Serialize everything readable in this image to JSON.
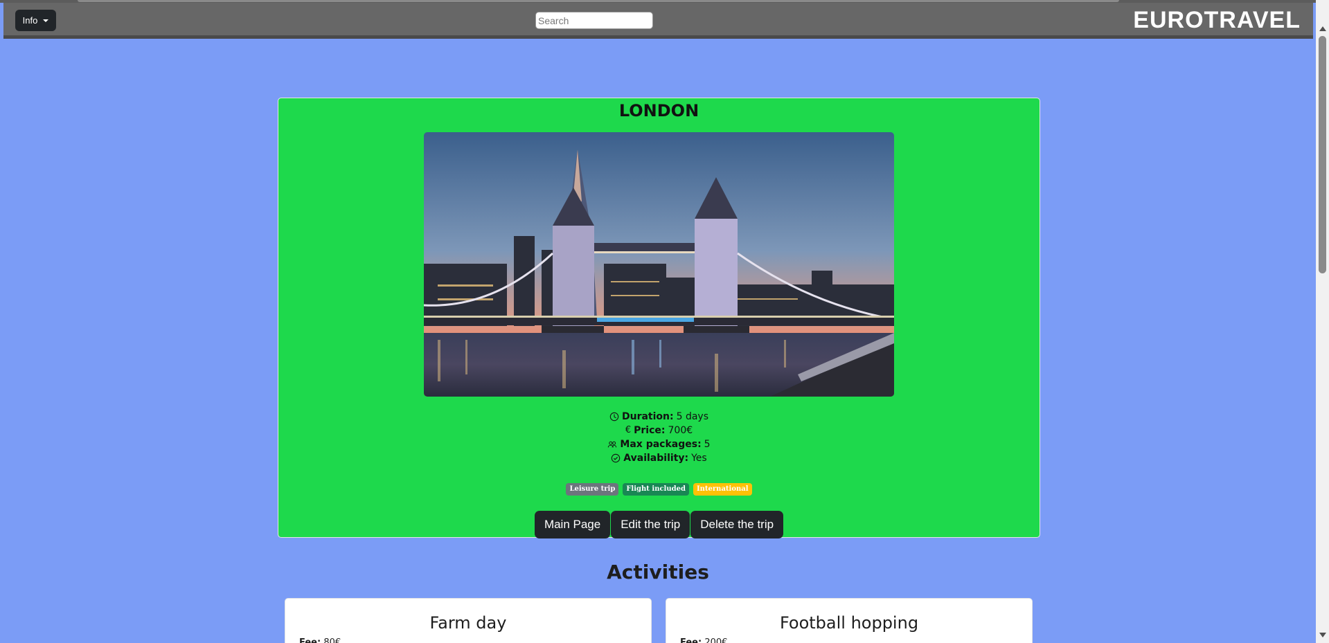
{
  "navbar": {
    "info_label": "Info",
    "search_placeholder": "Search",
    "brand": "EUROTRAVEL"
  },
  "trip": {
    "title": "LONDON",
    "image_alt": "London Tower Bridge at dusk",
    "details": [
      {
        "icon": "clock-icon",
        "label": "Duration:",
        "value": "5 days"
      },
      {
        "icon": "euro-icon",
        "label": "Price:",
        "value": "700€"
      },
      {
        "icon": "people-icon",
        "label": "Max packages:",
        "value": "5"
      },
      {
        "icon": "check-circle-icon",
        "label": "Availability:",
        "value": "Yes"
      }
    ],
    "badges": [
      {
        "label": "Leisure trip",
        "color": "#6c757d"
      },
      {
        "label": "Flight included",
        "color": "#198754"
      },
      {
        "label": "International",
        "color": "#ffc107"
      }
    ],
    "buttons": {
      "main_page": "Main Page",
      "edit": "Edit the trip",
      "delete": "Delete the trip"
    }
  },
  "activities": {
    "title": "Activities",
    "items": [
      {
        "name": "Farm day",
        "fee_label": "Fee:",
        "fee_value": "80€"
      },
      {
        "name": "Football hopping",
        "fee_label": "Fee:",
        "fee_value": "200€"
      }
    ]
  }
}
